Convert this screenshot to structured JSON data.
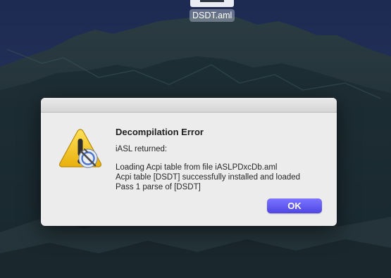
{
  "desktop": {
    "file": {
      "name": "DSDT.aml",
      "icon": "document-icon"
    }
  },
  "dialog": {
    "icon": "warning-icon",
    "title": "Decompilation Error",
    "subtitle": "iASL returned:",
    "lines": [
      "Loading Acpi table from file iASLPDxcDb.aml",
      "Acpi table [DSDT] successfully installed and loaded",
      "Pass 1 parse of [DSDT]"
    ],
    "ok_label": "OK"
  },
  "colors": {
    "accent": "#5a52f0",
    "dialog_bg": "#ececec",
    "warning_yellow": "#f3c51d"
  }
}
